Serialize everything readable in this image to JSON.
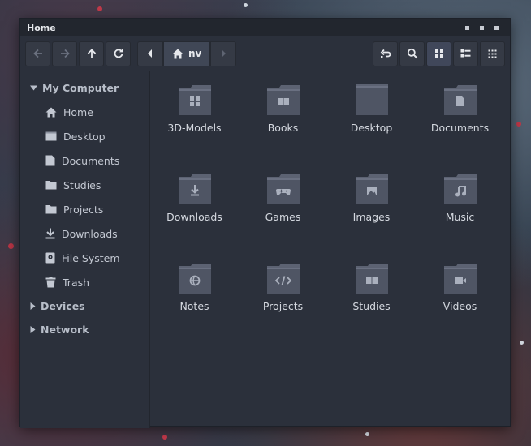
{
  "window": {
    "title": "Home"
  },
  "toolbar": {
    "path_crumb": "nv"
  },
  "sidebar": {
    "my_computer": "My Computer",
    "items": [
      {
        "label": "Home",
        "icon": "home-icon"
      },
      {
        "label": "Desktop",
        "icon": "desktop-icon"
      },
      {
        "label": "Documents",
        "icon": "document-icon"
      },
      {
        "label": "Studies",
        "icon": "folder-icon"
      },
      {
        "label": "Projects",
        "icon": "folder-icon"
      },
      {
        "label": "Downloads",
        "icon": "download-icon"
      },
      {
        "label": "File System",
        "icon": "drive-icon"
      },
      {
        "label": "Trash",
        "icon": "trash-icon"
      }
    ],
    "devices": "Devices",
    "network": "Network"
  },
  "files": [
    {
      "label": "3D-Models",
      "emblem": "grid"
    },
    {
      "label": "Books",
      "emblem": "book"
    },
    {
      "label": "Desktop",
      "emblem": "desktop"
    },
    {
      "label": "Documents",
      "emblem": "doc"
    },
    {
      "label": "Downloads",
      "emblem": "download"
    },
    {
      "label": "Games",
      "emblem": "gamepad"
    },
    {
      "label": "Images",
      "emblem": "image"
    },
    {
      "label": "Music",
      "emblem": "music"
    },
    {
      "label": "Notes",
      "emblem": "notes"
    },
    {
      "label": "Projects",
      "emblem": "code"
    },
    {
      "label": "Studies",
      "emblem": "book"
    },
    {
      "label": "Videos",
      "emblem": "video"
    }
  ],
  "colors": {
    "accent": "#5a6175",
    "folder": "#4f5564",
    "folder_tab": "#5c6272",
    "emblem": "#aab0bd"
  }
}
